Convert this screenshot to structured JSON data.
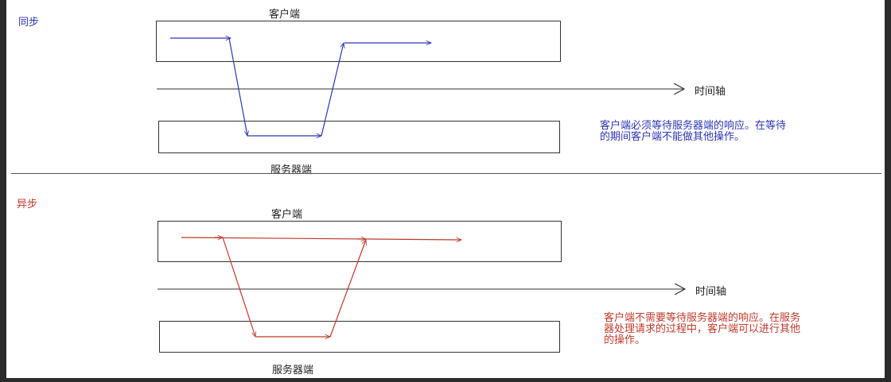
{
  "sync": {
    "heading": "同步",
    "client_label": "客户端",
    "server_label": "服务器端",
    "axis_label": "时间轴",
    "note_line1": "客户端必须等待服务器端的响应。在等待",
    "note_line2": "的期间客户端不能做其他操作。",
    "color": "#2d35b6"
  },
  "async": {
    "heading": "异步",
    "client_label": "客户端",
    "server_label": "服务器端",
    "axis_label": "时间轴",
    "note_line1": "客户端不需要等待服务器端的响应。在服务",
    "note_line2": "器处理请求的过程中，客户端可以进行其他",
    "note_line3": "的操作。",
    "color": "#c0392b"
  },
  "colors": {
    "outer_bg": "#2b2b2b",
    "canvas_bg": "#ffffff",
    "line": "#333333"
  }
}
